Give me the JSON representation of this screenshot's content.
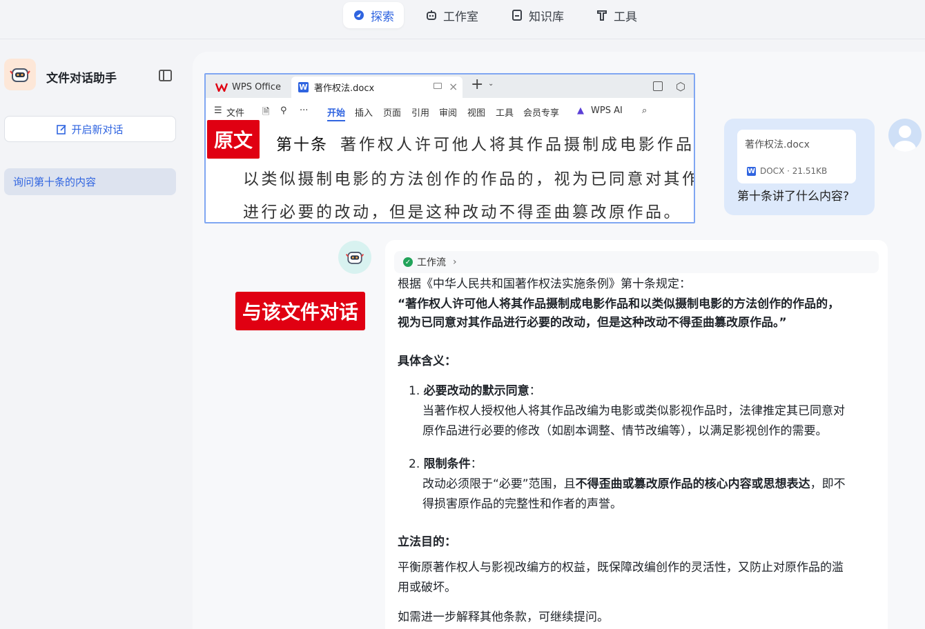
{
  "topnav": {
    "tabs": [
      {
        "label": "探索",
        "icon": "explore-icon",
        "active": true
      },
      {
        "label": "工作室",
        "icon": "robot-icon",
        "active": false
      },
      {
        "label": "知识库",
        "icon": "book-icon",
        "active": false
      },
      {
        "label": "工具",
        "icon": "tool-icon",
        "active": false
      }
    ]
  },
  "sidebar": {
    "app_title": "文件对话助手",
    "new_chat_label": "开启新对话",
    "history": [
      {
        "label": "询问第十条的内容"
      }
    ]
  },
  "wps": {
    "tab_home": "WPS Office",
    "tab_doc": "著作权法.docx",
    "toolbar": {
      "file": "文件",
      "items": [
        "开始",
        "插入",
        "页面",
        "引用",
        "审阅",
        "视图",
        "工具",
        "会员专享"
      ],
      "active": "开始",
      "ai": "WPS AI"
    },
    "badge": "原文",
    "article": "第十条",
    "lines": [
      "著作权人许可他人将其作品摄制成电影作品和",
      "以类似摄制电影的方法创作的作品的，视为已同意对其作品",
      "进行必要的改动，但是这种改动不得歪曲篡改原作品。"
    ]
  },
  "user_message": {
    "file_name": "著作权法.docx",
    "file_meta": "DOCX · 21.51KB",
    "question": "第十条讲了什么内容?"
  },
  "annotation_label": "与该文件对话",
  "answer": {
    "workflow_label": "工作流",
    "intro": "根据《中华人民共和国著作权法实施条例》第十条规定：",
    "quote_1": "“著作权人许可他人将其作品摄制成电影作品和以类似摄制电影的方法创作的作品的，",
    "quote_2": "视为已同意对其作品进行必要的改动，但是这种改动不得歪曲篡改原作品。”",
    "meaning_heading": "具体含义：",
    "item1_num": "1.",
    "item1_title": "必要改动的默示同意",
    "item1_line1": "当著作权人授权他人将其作品改编为电影或类似影视作品时，法律推定其已同意对",
    "item1_line2": "原作品进行必要的修改（如剧本调整、情节改编等），以满足影视创作的需要。",
    "item2_num": "2.",
    "item2_title": "限制条件",
    "item2_pre": "改动必须限于“必要”范围，且",
    "item2_bold": "不得歪曲或篡改原作品的核心内容或思想表达",
    "item2_post": "，即不",
    "item2_line2": "得损害原作品的完整性和作者的声誉。",
    "purpose_heading": "立法目的：",
    "purpose_line1": "平衡原著作权人与影视改编方的权益，既保障改编创作的灵活性，又防止对原作品的滥",
    "purpose_line2": "用或破坏。",
    "closing": "如需进一步解释其他条款，可继续提问。"
  },
  "colors": {
    "accent": "#2f64e0",
    "red_label": "#e00012",
    "user_bubble": "#dde9fb"
  }
}
